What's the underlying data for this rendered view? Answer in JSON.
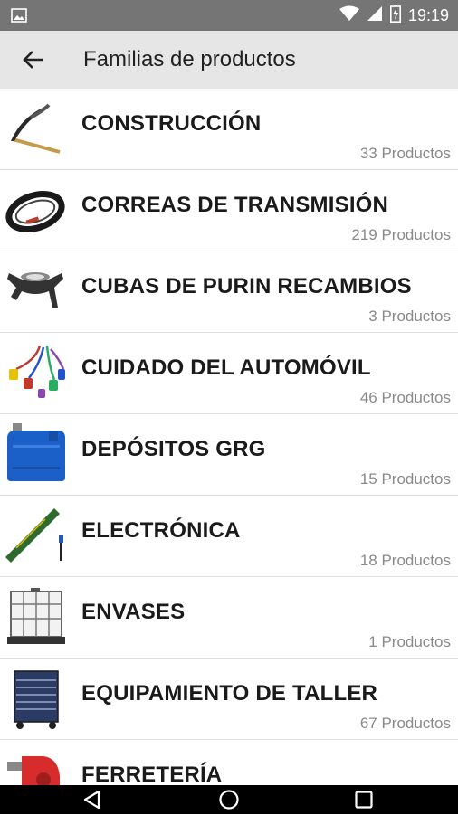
{
  "status_bar": {
    "time": "19:19"
  },
  "toolbar": {
    "title": "Familias de productos"
  },
  "families": [
    {
      "name": "CONSTRUCCIÓN",
      "count": "33 Productos"
    },
    {
      "name": "CORREAS DE TRANSMISIÓN",
      "count": "219 Productos"
    },
    {
      "name": "CUBAS DE PURIN RECAMBIOS",
      "count": "3 Productos"
    },
    {
      "name": "CUIDADO DEL AUTOMÓVIL",
      "count": "46 Productos"
    },
    {
      "name": "DEPÓSITOS GRG",
      "count": "15 Productos"
    },
    {
      "name": "ELECTRÓNICA",
      "count": "18 Productos"
    },
    {
      "name": "ENVASES",
      "count": "1 Productos"
    },
    {
      "name": "EQUIPAMIENTO DE TALLER",
      "count": "67 Productos"
    },
    {
      "name": "FERRETERÍA",
      "count": ""
    }
  ]
}
